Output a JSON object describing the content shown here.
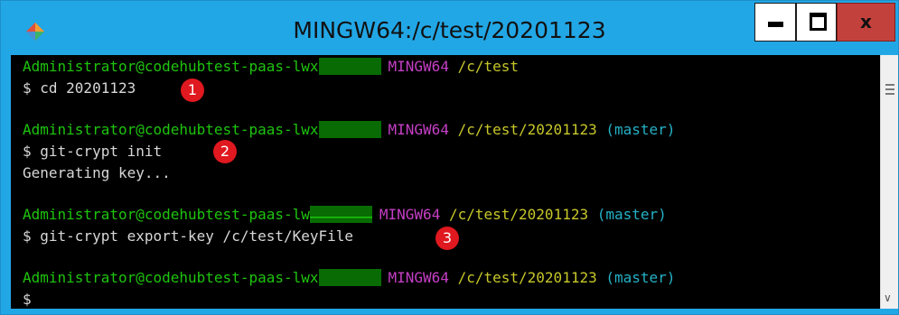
{
  "window": {
    "title": "MINGW64:/c/test/20201123",
    "app_icon": "git-bash-diamond-icon",
    "controls": {
      "minimize_icon": "minimize-icon",
      "maximize_icon": "maximize-icon",
      "close_label": "x"
    },
    "colors": {
      "frame": "#22a7e6",
      "close": "#c3413d",
      "terminal_bg": "#000000"
    }
  },
  "terminal": {
    "blocks": [
      {
        "user": "Administrator@codehubtest-paas-lwx",
        "host": "MINGW64",
        "path": "/c/test",
        "branch": "",
        "command": "$ cd 20201123",
        "output": "",
        "step": "1"
      },
      {
        "user": "Administrator@codehubtest-paas-lwx",
        "host": "MINGW64",
        "path": "/c/test/20201123",
        "branch": "(master)",
        "command": "$ git-crypt init",
        "output": "Generating key...",
        "step": "2"
      },
      {
        "user": "Administrator@codehubtest-paas-lw",
        "host": "MINGW64",
        "path": "/c/test/20201123",
        "branch": "(master)",
        "command": "$ git-crypt export-key /c/test/KeyFile",
        "output": "",
        "step": "3"
      },
      {
        "user": "Administrator@codehubtest-paas-lwx",
        "host": "MINGW64",
        "path": "/c/test/20201123",
        "branch": "(master)",
        "command": "$",
        "output": "",
        "step": ""
      }
    ],
    "colors": {
      "user": "#1ec40d",
      "host": "#c53fc5",
      "path": "#c7c72a",
      "branch": "#24b1c6",
      "step_marker": "#e0181f"
    }
  },
  "scrollbar": {
    "down_icon": "chevron-down-icon",
    "grip_icon": "scroll-grip-icon"
  }
}
